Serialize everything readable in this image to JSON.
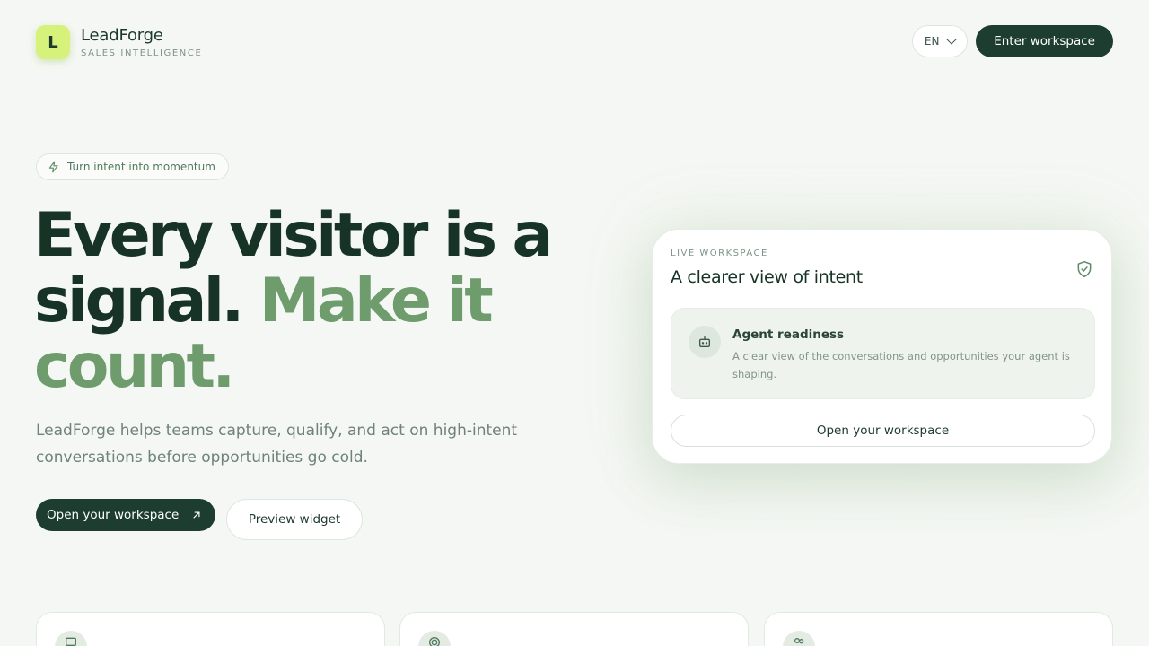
{
  "header": {
    "logo_letter": "L",
    "brand_name": "LeadForge",
    "brand_tagline": "SALES INTELLIGENCE",
    "language": "EN",
    "enter_label": "Enter workspace"
  },
  "hero": {
    "badge": "Turn intent into momentum",
    "headline_dark": "Every visitor is a signal.",
    "headline_accent": "Make it count.",
    "subtitle": "LeadForge helps teams capture, qualify, and act on high-intent conversations before opportunities go cold.",
    "primary_cta": "Open your workspace",
    "secondary_cta": "Preview widget"
  },
  "card": {
    "eyebrow": "LIVE WORKSPACE",
    "title": "A clearer view of intent",
    "item_title": "Agent readiness",
    "item_desc": "A clear view of the conversations and opportunities your agent is shaping.",
    "button": "Open your workspace"
  },
  "features": [
    {
      "icon": "chat-icon"
    },
    {
      "icon": "fingerprint-icon"
    },
    {
      "icon": "users-icon"
    }
  ],
  "colors": {
    "background": "#f4f7f3",
    "brand_dark": "#1c3d2f",
    "accent_green": "#6e9c6c",
    "logo_lime": "#d7f27a"
  }
}
